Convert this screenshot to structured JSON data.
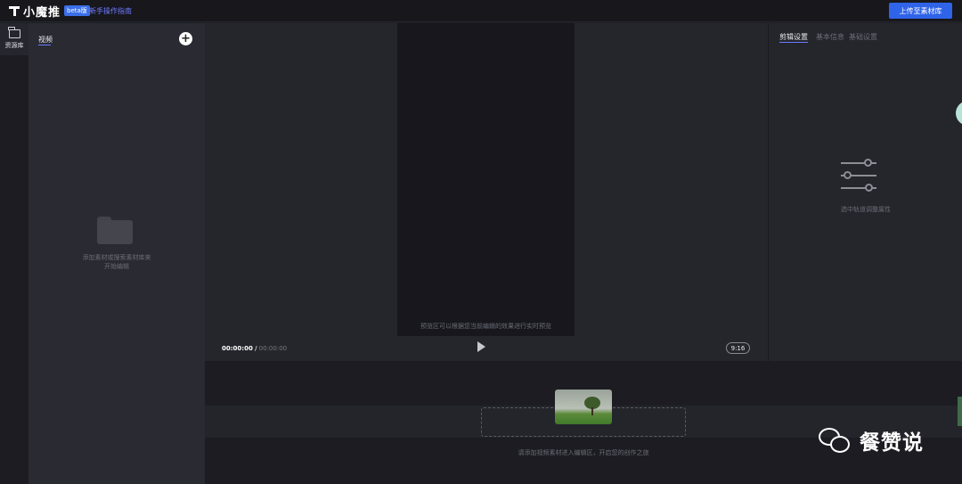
{
  "header": {
    "app_name": "小魔推",
    "beta_badge": "beta版",
    "guide_link": "新手操作指南",
    "upload_button": "上传至素材库"
  },
  "rail": {
    "items": [
      {
        "label": "资源库",
        "icon": "folder-icon",
        "active": true
      }
    ]
  },
  "library": {
    "tab": "视频",
    "add_icon": "plus-icon",
    "empty_line1": "添加素材或搜索素材库来",
    "empty_line2": "开始编辑"
  },
  "preview": {
    "hint": "预览区可以根据您当前编辑的效果进行实时预览",
    "time_current": "00:00:00",
    "time_separator": "/",
    "time_total": "00:00:00",
    "aspect_ratio": "9:16"
  },
  "properties": {
    "tabs": [
      "剪辑设置",
      "基本信息",
      "基础设置"
    ],
    "active_tab_index": 0,
    "hint": "选中轨道调整属性"
  },
  "timeline": {
    "hint": "请添加视频素材进入编辑区，开启您的创作之旅"
  },
  "watermark": {
    "text": "餐赞说"
  },
  "colors": {
    "accent": "#2f63e8",
    "link": "#6f7bff",
    "background": "#1d1d24"
  }
}
